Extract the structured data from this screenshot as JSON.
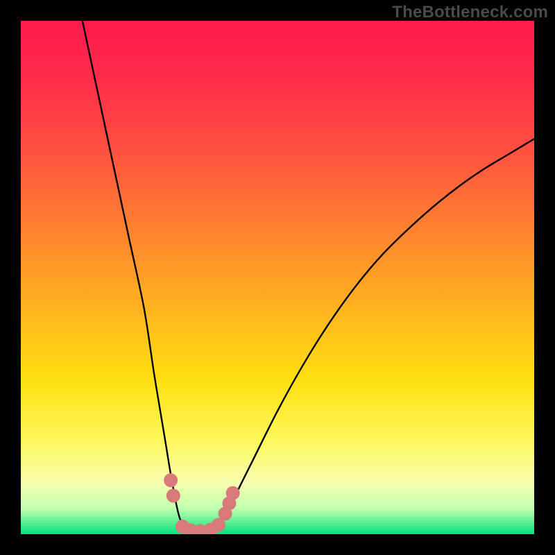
{
  "watermark": "TheBottleneck.com",
  "chart_data": {
    "type": "line",
    "title": "",
    "xlabel": "",
    "ylabel": "",
    "xlim": [
      0,
      100
    ],
    "ylim": [
      0,
      100
    ],
    "series": [
      {
        "name": "bottleneck-curve",
        "x": [
          12,
          15,
          18,
          21,
          24,
          26,
          28,
          29.5,
          31,
          33,
          35,
          37,
          39,
          41,
          45,
          50,
          55,
          60,
          65,
          70,
          75,
          80,
          85,
          90,
          95,
          100
        ],
        "y": [
          100,
          86,
          72,
          58,
          44,
          31,
          19,
          10,
          3,
          0,
          0,
          0,
          2,
          6,
          14,
          24,
          33,
          41,
          48,
          54,
          59,
          63.5,
          67.5,
          71,
          74,
          77
        ]
      }
    ],
    "markers": {
      "name": "highlight-band",
      "color": "#d87a7a",
      "points": [
        {
          "x": 29.2,
          "y": 10.5
        },
        {
          "x": 29.7,
          "y": 7.5
        },
        {
          "x": 31.5,
          "y": 1.5
        },
        {
          "x": 33.0,
          "y": 0.8
        },
        {
          "x": 35.0,
          "y": 0.6
        },
        {
          "x": 37.0,
          "y": 0.9
        },
        {
          "x": 38.5,
          "y": 1.8
        },
        {
          "x": 39.8,
          "y": 4.0
        },
        {
          "x": 40.6,
          "y": 6.0
        },
        {
          "x": 41.3,
          "y": 8.0
        }
      ]
    }
  }
}
